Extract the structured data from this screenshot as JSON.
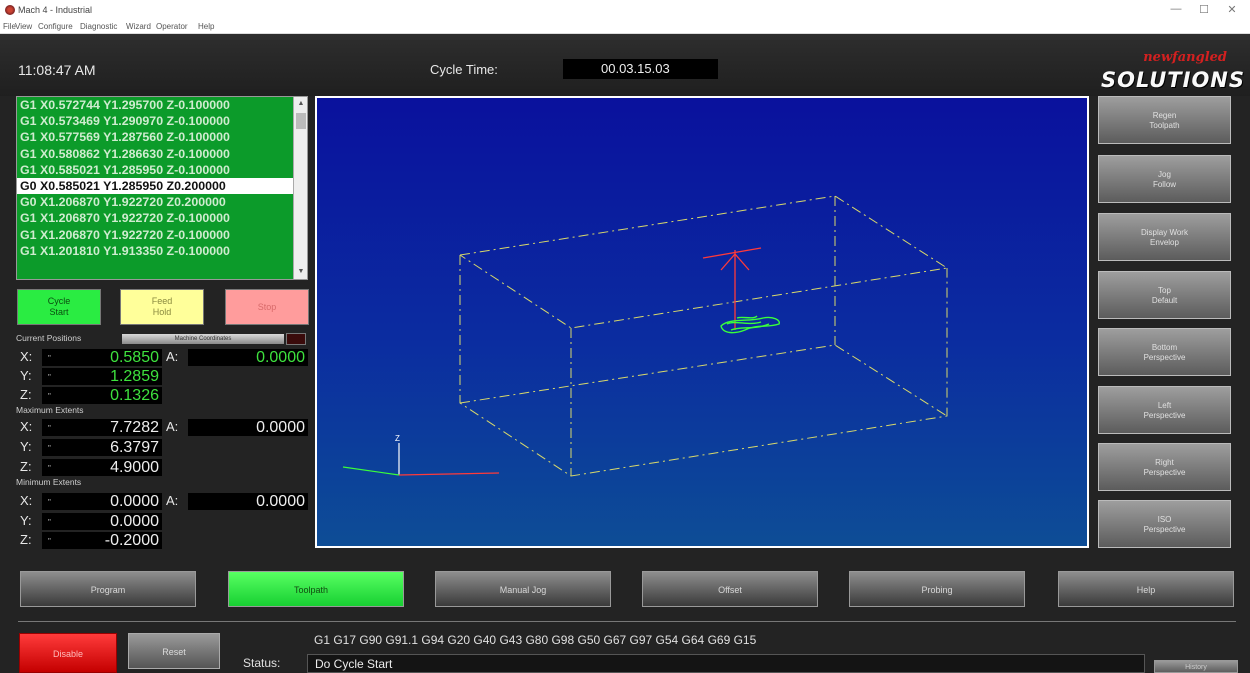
{
  "window": {
    "title": "Mach 4 - Industrial",
    "minimize_glyph": "—",
    "maximize_glyph": "☐",
    "close_glyph": "✕"
  },
  "menu": [
    "File",
    "View",
    "Configure",
    "Diagnostic",
    "Wizard",
    "Operator",
    "Help"
  ],
  "header": {
    "clock": "11:08:47 AM",
    "cycle_time_label": "Cycle Time:",
    "cycle_time_value": "00.03.15.03"
  },
  "logo": {
    "line1": "newfangled",
    "line2": "SOLUTIONS"
  },
  "gcode_lines": [
    "G1 X0.572744 Y1.295700 Z-0.100000",
    "G1 X0.573469 Y1.290970 Z-0.100000",
    "G1 X0.577569 Y1.287560 Z-0.100000",
    "G1 X0.580862 Y1.286630 Z-0.100000",
    "G1 X0.585021 Y1.285950 Z-0.100000",
    "G0 X0.585021 Y1.285950 Z0.200000",
    "G0 X1.206870 Y1.922720 Z0.200000",
    "G1 X1.206870 Y1.922720 Z-0.100000",
    "G1 X1.206870 Y1.922720 Z-0.100000",
    "G1 X1.201810 Y1.913350 Z-0.100000"
  ],
  "gcode_current_index": 5,
  "cycle_buttons": {
    "start": "Cycle\nStart",
    "hold": "Feed\nHold",
    "stop": "Stop"
  },
  "dro": {
    "current_caption": "Current Positions",
    "machine_coords_label": "Machine Coordinates",
    "current": {
      "x": "0.5850",
      "y": "1.2859",
      "z": "0.1326",
      "a": "0.0000"
    },
    "max_caption": "Maximum Extents",
    "max": {
      "x": "7.7282",
      "y": "6.3797",
      "z": "4.9000",
      "a": "0.0000"
    },
    "min_caption": "Minimum Extents",
    "min": {
      "x": "0.0000",
      "y": "0.0000",
      "z": "-0.2000",
      "a": "0.0000"
    },
    "axis_labels": {
      "x": "X:",
      "y": "Y:",
      "z": "Z:",
      "a": "A:"
    },
    "tick": "\""
  },
  "viewport": {
    "axis_z_label": "Z"
  },
  "view_buttons": [
    "Regen\nToolpath",
    "Jog\nFollow",
    "Display Work\nEnvelop",
    "Top\nDefault",
    "Bottom\nPerspective",
    "Left\nPerspective",
    "Right\nPerspective",
    "ISO\nPerspective"
  ],
  "tabs": [
    "Program",
    "Toolpath",
    "Manual Jog",
    "Offset",
    "Probing",
    "Help"
  ],
  "active_tab_index": 1,
  "bottom": {
    "disable": "Disable",
    "reset": "Reset",
    "modal_codes": "G1 G17 G90 G91.1 G94 G20 G40 G43 G80 G98 G50 G67 G97 G54 G64 G69 G15",
    "status_label": "Status:",
    "status_value": "Do Cycle Start",
    "history": "History"
  },
  "colors": {
    "gcode_bg": "#0c9b2a",
    "viewport_top": "#0a119d",
    "viewport_bottom": "#0d4d96",
    "active_tab": "#2aec42",
    "disable": "#e00000"
  }
}
